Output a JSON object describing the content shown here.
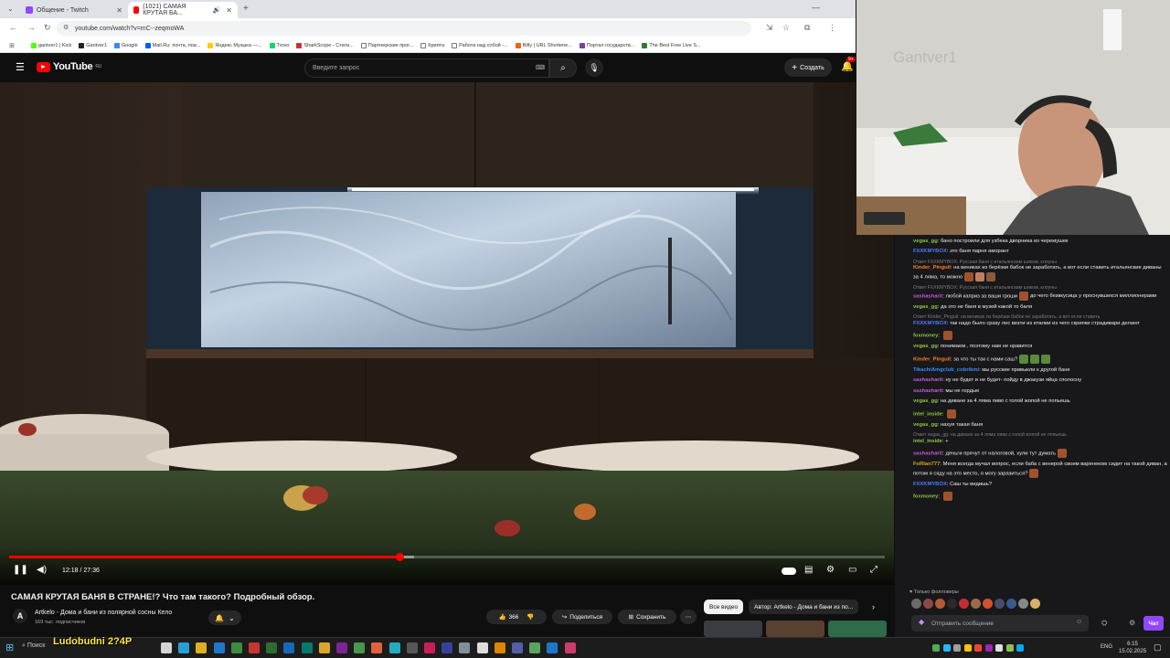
{
  "browser": {
    "tabs": [
      {
        "title": "Общение - Twitch",
        "active": false
      },
      {
        "title": "(1021) САМАЯ КРУТАЯ БА...",
        "active": true
      }
    ],
    "url": "youtube.com/watch?v=mC--zeqmoWA",
    "bookmarks": [
      "gantver1 | Kick",
      "Gantver1",
      "Google",
      "Mail.Ru: почта, пои...",
      "Яндекс Музыка —...",
      "Trovo",
      "SharkScope - Стати...",
      "Партнерские прог...",
      "Крипта",
      "Работа над собой -...",
      "Bitly | URL Shortene...",
      "Портал государств...",
      "The Best Free Live S..."
    ]
  },
  "youtube": {
    "logo_text": "YouTube",
    "logo_region": "RU",
    "search_placeholder": "Введите запрос",
    "create_label": "Создать",
    "notif_count": "9+"
  },
  "player": {
    "time_current": "12:18",
    "time_total": "27:36",
    "progress": 0.4457,
    "buffered": 0.462
  },
  "video_info": {
    "title": "САМАЯ КРУТАЯ БАНЯ В СТРАНЕ!? Что там такого? Подробный обзор.",
    "channel_initial": "A",
    "channel_name": "Artkelo - Дома и бани из полярной сосны Кело",
    "subscribers": "169 тыс. подписчиков",
    "likes": "366",
    "share_label": "Поделиться",
    "save_label": "Сохранить"
  },
  "related_filters": [
    "Все видео",
    "Автор: Artkelo - Дома и бани из по..."
  ],
  "chat": {
    "messages": [
      {
        "user": "vegas_gg",
        "color": "#8ec63f",
        "text": "бано построили для узбека дворника из черемушек"
      },
      {
        "user": "FXXKMYBOX",
        "color": "#4d7cff",
        "text": "это баня парня аморант"
      },
      {
        "reply": "Ответ FXXKMYBOX: Русская баня с итальянским шиком, клоуны"
      },
      {
        "user": "Kinder_Pinguil",
        "color": "#ff7f24",
        "text": "на вениках из берёзки бабок не заработать, а вот если ставить итальянские диваны за 4 ляма, то можно",
        "emotes": 3
      },
      {
        "reply": "Ответ FXXKMYBOX: Русская баня с итальянским шиком, клоуны"
      },
      {
        "user": "sashasharit",
        "color": "#c45ad4",
        "text": "любой каприз за ваши гроши",
        "text2": "до чего безвкусица у проснувшихся миллионерами",
        "emotes": 1
      },
      {
        "user": "vegas_gg",
        "color": "#8ec63f",
        "text": "да это не баня в музей какой то баля"
      },
      {
        "reply": "Ответ Kinder_Pinguil: на вениках из берёзки бабок не заработать, а вот если ставить"
      },
      {
        "user": "FXXKMYBOX",
        "color": "#4d7cff",
        "text": "так надо было сразу лес везти из италии из чего скрипки страдивари делают"
      },
      {
        "user": "foxmoney",
        "color": "#8ec63f",
        "text": "",
        "emotes": 1
      },
      {
        "user": "vegas_gg",
        "color": "#8ec63f",
        "text": "понимаем , поэтому нам не нравится"
      },
      {
        "user": "Kinder_Pinguil",
        "color": "#ff7f24",
        "text": "за что ты так с нами саш?",
        "emotes": 3,
        "emote_color": "#5a8a3a"
      },
      {
        "user": "TikachiAmgclub_cobrikmi",
        "color": "#3d8bff",
        "text": "мы русские привыкли к другой бане"
      },
      {
        "user": "sashasharit",
        "color": "#c45ad4",
        "text": "ну не будет и не будет- пойду в джакузи яйца сполосну"
      },
      {
        "user": "sashasharit",
        "color": "#c45ad4",
        "text": "мы не гордые"
      },
      {
        "user": "vegas_gg",
        "color": "#8ec63f",
        "text": "на диване за 4 ляма пиво с голой жопой не попьешь"
      },
      {
        "user": "intel_inside",
        "color": "#8ec63f",
        "text": "",
        "emotes": 1
      },
      {
        "user": "vegas_gg",
        "color": "#8ec63f",
        "text": "нахуя такая баня"
      },
      {
        "reply": "Ответ vegas_gg: на диване за 4 ляма пиво с голой жопой не попьешь"
      },
      {
        "user": "intel_inside",
        "color": "#8ec63f",
        "text": "+"
      },
      {
        "user": "sashasharit",
        "color": "#c45ad4",
        "text": "деньги прячут от налоговой, хули тут думать",
        "emotes": 1
      },
      {
        "user": "FoRlan777",
        "color": "#daa520",
        "text": "Меня всегда мучал вопрос, если баба с венерой своим варенеком сидит на такой диван, а потом я сяду на это место, я могу заразиться?",
        "emotes": 1
      },
      {
        "user": "FXXKMYBOX",
        "color": "#4d7cff",
        "text": "Саш ты видишь?"
      },
      {
        "user": "foxmoney",
        "color": "#8ec63f",
        "text": "",
        "emotes": 1
      }
    ],
    "followers_label": "Только фолловеры",
    "input_placeholder": "Отправить сообщение",
    "send_label": "Чат"
  },
  "taskbar": {
    "search_label": "Поиск",
    "overlay_text": "Ludobudni 2?4P",
    "lang": "ENG",
    "time": "6:15",
    "date": "15.02.2025"
  }
}
